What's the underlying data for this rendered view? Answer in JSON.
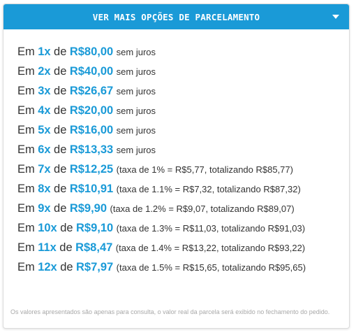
{
  "header": {
    "title": "VER MAIS OPÇÕES DE PARCELAMENTO",
    "toggle_icon": "caret-down-icon"
  },
  "installments": [
    {
      "prefix": "Em",
      "times": "1x",
      "of": "de",
      "amount": "R$80,00",
      "suffix": "sem juros"
    },
    {
      "prefix": "Em",
      "times": "2x",
      "of": "de",
      "amount": "R$40,00",
      "suffix": "sem juros"
    },
    {
      "prefix": "Em",
      "times": "3x",
      "of": "de",
      "amount": "R$26,67",
      "suffix": "sem juros"
    },
    {
      "prefix": "Em",
      "times": "4x",
      "of": "de",
      "amount": "R$20,00",
      "suffix": "sem juros"
    },
    {
      "prefix": "Em",
      "times": "5x",
      "of": "de",
      "amount": "R$16,00",
      "suffix": "sem juros"
    },
    {
      "prefix": "Em",
      "times": "6x",
      "of": "de",
      "amount": "R$13,33",
      "suffix": "sem juros"
    },
    {
      "prefix": "Em",
      "times": "7x",
      "of": "de",
      "amount": "R$12,25",
      "suffix": "(taxa de 1% = R$5,77, totalizando R$85,77)"
    },
    {
      "prefix": "Em",
      "times": "8x",
      "of": "de",
      "amount": "R$10,91",
      "suffix": "(taxa de 1.1% = R$7,32, totalizando R$87,32)"
    },
    {
      "prefix": "Em",
      "times": "9x",
      "of": "de",
      "amount": "R$9,90",
      "suffix": "(taxa de 1.2% = R$9,07, totalizando R$89,07)"
    },
    {
      "prefix": "Em",
      "times": "10x",
      "of": "de",
      "amount": "R$9,10",
      "suffix": "(taxa de 1.3% = R$11,03, totalizando R$91,03)"
    },
    {
      "prefix": "Em",
      "times": "11x",
      "of": "de",
      "amount": "R$8,47",
      "suffix": "(taxa de 1.4% = R$13,22, totalizando R$93,22)"
    },
    {
      "prefix": "Em",
      "times": "12x",
      "of": "de",
      "amount": "R$7,97",
      "suffix": "(taxa de 1.5% = R$15,65, totalizando R$95,65)"
    }
  ],
  "footnote": "Os valores apresentados são apenas para consulta, o valor real da parcela será exibido no fechamento do pedido.",
  "colors": {
    "accent": "#1a9ad7",
    "text": "#333333",
    "muted": "#a9a9a9"
  }
}
